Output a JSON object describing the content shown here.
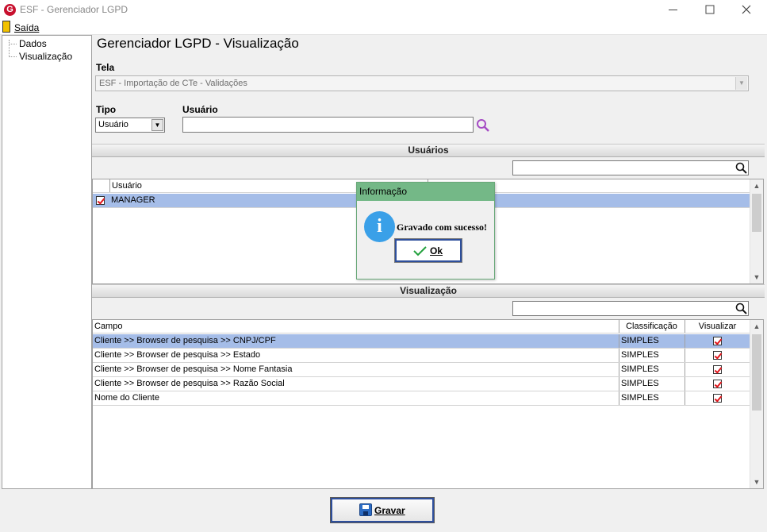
{
  "window": {
    "title": "ESF - Gerenciador LGPD",
    "logo_letter": "G",
    "minimize": "—",
    "maximize": "☐",
    "close": "✕"
  },
  "menu": {
    "exit_label": "Saída"
  },
  "tree": {
    "items": [
      {
        "label": "Dados"
      },
      {
        "label": "Visualização"
      }
    ]
  },
  "page": {
    "title": "Gerenciador LGPD - Visualização",
    "screen_label": "Tela",
    "screen_value": "ESF - Importação de CTe - Validações",
    "type_label": "Tipo",
    "type_value": "Usuário",
    "user_label": "Usuário",
    "user_value": ""
  },
  "users_section": {
    "title": "Usuários",
    "filter_value": "",
    "columns": [
      "Usuário"
    ],
    "rows": [
      {
        "name": "MANAGER",
        "checked": true
      }
    ]
  },
  "view_section": {
    "title": "Visualização",
    "filter_value": "",
    "columns": [
      "Campo",
      "Classificação",
      "Visualizar"
    ],
    "rows": [
      {
        "field": "Cliente >> Browser de pesquisa >> CNPJ/CPF",
        "classification": "SIMPLES",
        "visible": true
      },
      {
        "field": "Cliente >> Browser de pesquisa >> Estado",
        "classification": "SIMPLES",
        "visible": true
      },
      {
        "field": "Cliente >> Browser de pesquisa >> Nome Fantasia",
        "classification": "SIMPLES",
        "visible": true
      },
      {
        "field": "Cliente >> Browser de pesquisa >> Razão Social",
        "classification": "SIMPLES",
        "visible": true
      },
      {
        "field": "Nome do Cliente",
        "classification": "SIMPLES",
        "visible": true
      }
    ]
  },
  "dialog": {
    "title": "Informação",
    "icon_glyph": "i",
    "message": "Gravado com sucesso!",
    "ok_label": "Ok"
  },
  "footer": {
    "save_label": "Gravar"
  },
  "colors": {
    "dialog_title": "#74b887",
    "selected_row": "#a5bde8",
    "checkmark": "#e0151b",
    "button_border": "#2e4f9c"
  }
}
